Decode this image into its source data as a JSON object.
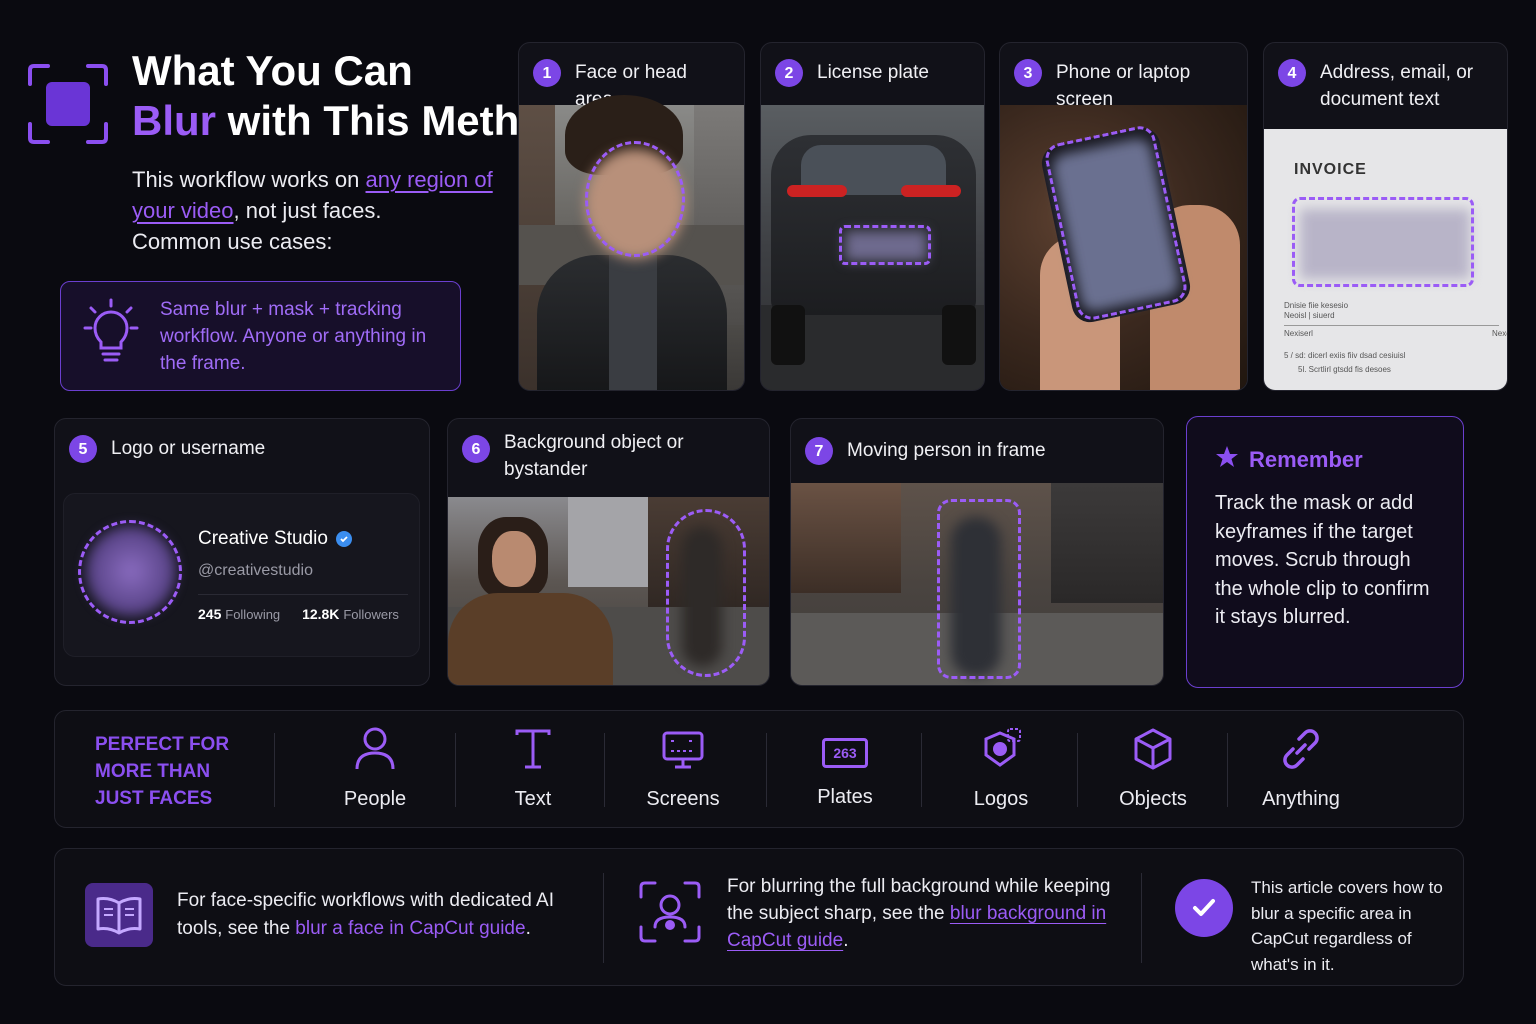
{
  "header": {
    "title_line1": "What You Can",
    "title_blur": "Blur",
    "title_rest": " with This Method",
    "desc_before": "This workflow works on ",
    "desc_link": "any region of your video",
    "desc_after": ", not just faces.",
    "desc_line3": "Common use cases:"
  },
  "tip": {
    "icon": "lightbulb-icon",
    "text": "Same blur + mask + tracking workflow. Anyone or anything in the frame."
  },
  "cards": [
    {
      "num": "1",
      "label": "Face or head area"
    },
    {
      "num": "2",
      "label": "License plate"
    },
    {
      "num": "3",
      "label": "Phone or laptop screen"
    },
    {
      "num": "4",
      "label": "Address, email, or document text"
    },
    {
      "num": "5",
      "label": "Logo or username"
    },
    {
      "num": "6",
      "label": "Background object or bystander"
    },
    {
      "num": "7",
      "label": "Moving person in frame"
    }
  ],
  "invoice": {
    "title": "INVOICE",
    "line1": "Dnisie fiie kesesio",
    "line2": "Neoisl | siuerd",
    "line3": "Nexiserl",
    "line4": "Nexe",
    "line5": "5 / sd: dicerl exiis fiiv dsad cesiuisl",
    "line6": "5l. Scrtlirl gtsdd fis desoes"
  },
  "profile": {
    "name": "Creative Studio",
    "handle": "@creativestudio",
    "following_count": "245",
    "following_label": "Following",
    "followers_count": "12.8K",
    "followers_label": "Followers"
  },
  "remember": {
    "title": "Remember",
    "text": "Track the mask or add keyframes if the target moves. Scrub through the whole clip to confirm it stays blurred."
  },
  "strip": {
    "heading": "PERFECT FOR MORE THAN JUST FACES",
    "items": [
      {
        "icon": "person-icon",
        "label": "People"
      },
      {
        "icon": "text-icon",
        "label": "Text"
      },
      {
        "icon": "screen-icon",
        "label": "Screens"
      },
      {
        "icon": "plate-icon",
        "label": "Plates",
        "plate_text": "263"
      },
      {
        "icon": "logo-icon",
        "label": "Logos"
      },
      {
        "icon": "cube-icon",
        "label": "Objects"
      },
      {
        "icon": "link-icon",
        "label": "Anything"
      }
    ]
  },
  "footer": {
    "col1_before": "For face-specific workflows with dedicated AI tools, see the ",
    "col1_link": "blur a face in CapCut guide",
    "col1_after": ".",
    "col2_before": "For blurring the full background while keeping the subject sharp, see the ",
    "col2_link": "blur background in CapCut guide",
    "col2_after": ".",
    "col3": "This article covers how to blur a specific area in CapCut regardless of what's in it."
  },
  "colors": {
    "accent": "#9b5cf6",
    "badge": "#7c46e6",
    "background": "#0a0a10",
    "card": "#111118"
  }
}
